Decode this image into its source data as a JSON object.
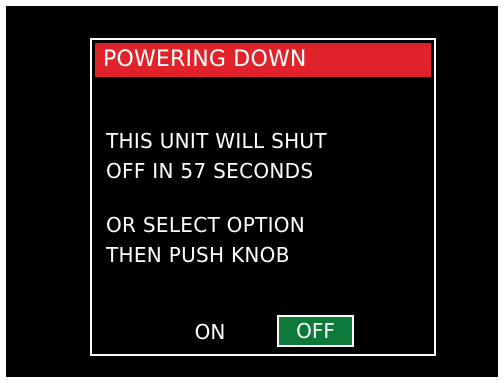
{
  "dialog": {
    "title": "POWERING DOWN",
    "message_lines": [
      "THIS UNIT WILL SHUT",
      "OFF IN 57 SECONDS"
    ],
    "instruction_lines": [
      "OR SELECT OPTION",
      "THEN PUSH KNOB"
    ],
    "options": [
      {
        "label": "ON",
        "selected": false
      },
      {
        "label": "OFF",
        "selected": true
      }
    ]
  },
  "colors": {
    "background": "#000000",
    "title_bar": "#e0232b",
    "selected_option": "#0e7a3a",
    "text": "#ffffff"
  }
}
